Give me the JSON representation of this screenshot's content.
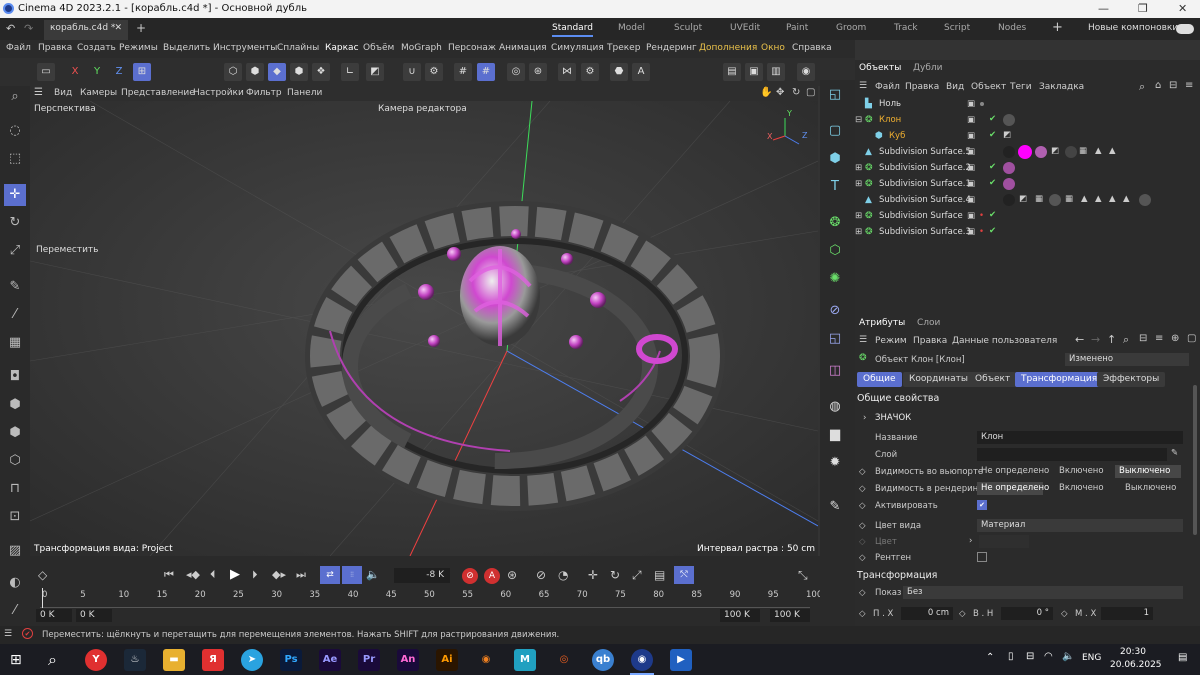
{
  "window": {
    "title": "Cinema 4D 2023.2.1 - [корабль.c4d *] - Основной дубль",
    "minimize": "—",
    "maximize": "❐",
    "close": "✕"
  },
  "doc_tab": {
    "name": "корабль.c4d *",
    "close": "✕",
    "add": "+"
  },
  "layouts": {
    "items": [
      "Standard",
      "Model",
      "Sculpt",
      "UVEdit",
      "Paint",
      "Groom",
      "Track",
      "Script",
      "Nodes"
    ],
    "active": "Standard",
    "add": "+",
    "new_layouts": "Новые компоновки"
  },
  "menu": [
    "Файл",
    "Правка",
    "Создать",
    "Режимы",
    "Выделить",
    "Инструменты",
    "Сплайны",
    "Каркас",
    "Объём",
    "MoGraph",
    "Персонаж",
    "Анимация",
    "Симуляция",
    "Трекер",
    "Рендеринг",
    "Дополнения",
    "Окно",
    "Справка"
  ],
  "toolbar": {
    "x": "X",
    "y": "Y",
    "z": "Z"
  },
  "viewport_menu": [
    "Вид",
    "Камеры",
    "Представление",
    "Настройки",
    "Фильтр",
    "Панели"
  ],
  "viewport": {
    "name": "Перспектива",
    "camera": "Камера редактора",
    "tool_label": "Переместить",
    "transform_info": "Трансформация вида: Project",
    "grid_info": "Интервал растра : 50 cm",
    "axis_x": "X",
    "axis_y": "Y",
    "axis_z": "Z"
  },
  "timeline": {
    "frame": "-8 K",
    "start": "0 K",
    "start2": "0 K",
    "end": "100 K",
    "end2": "100 K",
    "ruler": [
      "0",
      "5",
      "10",
      "15",
      "20",
      "25",
      "30",
      "35",
      "40",
      "45",
      "50",
      "55",
      "60",
      "65",
      "70",
      "75",
      "80",
      "85",
      "90",
      "95",
      "100"
    ]
  },
  "objects_panel": {
    "tabs": [
      "Объекты",
      "Дубли"
    ],
    "menu": [
      "Файл",
      "Правка",
      "Вид",
      "Объект",
      "Теги",
      "Закладка"
    ],
    "rows": [
      {
        "name": "Ноль",
        "color": "#dddddd"
      },
      {
        "name": "Клон",
        "color": "#f0b030"
      },
      {
        "name": "Куб",
        "color": "#f0b030"
      },
      {
        "name": "Subdivision Surface.5",
        "color": "#dddddd"
      },
      {
        "name": "Subdivision Surface.2",
        "color": "#dddddd"
      },
      {
        "name": "Subdivision Surface.1",
        "color": "#dddddd"
      },
      {
        "name": "Subdivision Surface.4",
        "color": "#dddddd"
      },
      {
        "name": "Subdivision Surface",
        "color": "#dddddd"
      },
      {
        "name": "Subdivision Surface.3",
        "color": "#dddddd"
      }
    ]
  },
  "attributes": {
    "tabs": [
      "Атрибуты",
      "Слои"
    ],
    "menu": [
      "Режим",
      "Правка",
      "Данные пользователя"
    ],
    "object_title": "Объект Клон [Клон]",
    "mode": "Изменено",
    "subtabs": [
      "Общие",
      "Координаты",
      "Объект",
      "Трансформация",
      "Эффекторы"
    ],
    "section": "Общие свойства",
    "icon_group": "ЗНАЧОК",
    "name_label": "Название",
    "name_value": "Клон",
    "layer_label": "Слой",
    "vis_editor_label": "Видимость во вьюпорте",
    "vis_render_label": "Видимость в рендеринге",
    "vis_options": [
      "Не определено",
      "Включено",
      "Выключено"
    ],
    "enabled_label": "Активировать",
    "display_color_label": "Цвет вида",
    "display_color_value": "Материал",
    "color_label": "Цвет",
    "xray_label": "Рентген",
    "transform_section": "Трансформация",
    "show_label": "Показ",
    "show_value": "Без",
    "px_label": "П . X",
    "px_value": "0 cm",
    "vh_label": "В . Н",
    "vh_value": "0 °",
    "mx_label": "М . X",
    "mx_value": "1"
  },
  "status": "Переместить: щёлкнуть и перетащить для перемещения элементов. Нажать SHIFT для растрирования движения.",
  "taskbar": {
    "lang": "ENG",
    "time": "20:30",
    "date": "20.06.2025"
  },
  "colors": {
    "accent": "#5b6fcf",
    "magenta": "#d040d0",
    "green": "#6adf6a"
  }
}
